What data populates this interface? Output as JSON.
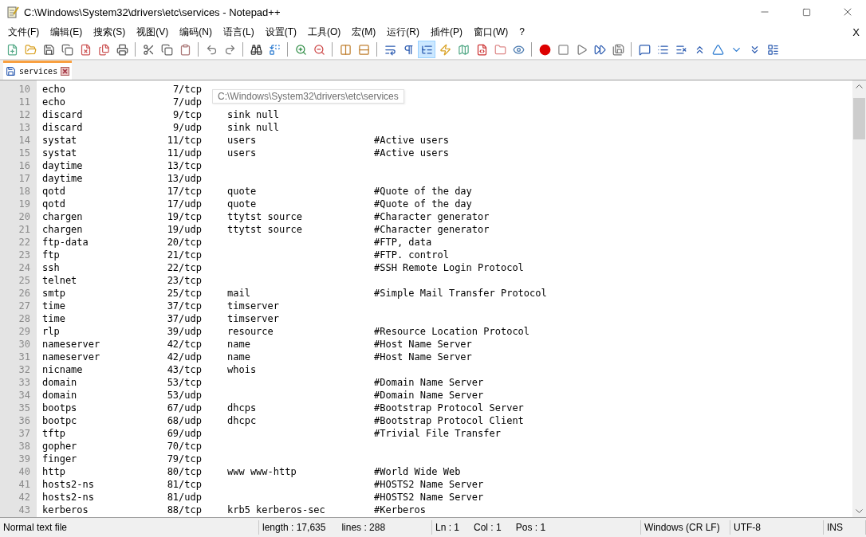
{
  "window": {
    "title": "C:\\Windows\\System32\\drivers\\etc\\services - Notepad++"
  },
  "menu": [
    "文件(F)",
    "编辑(E)",
    "搜索(S)",
    "视图(V)",
    "编码(N)",
    "语言(L)",
    "设置(T)",
    "工具(O)",
    "宏(M)",
    "运行(R)",
    "插件(P)",
    "窗口(W)",
    "?"
  ],
  "menu_close": "X",
  "toolbar": [
    {
      "kind": "button",
      "selected": false
    },
    {
      "kind": "button",
      "selected": false
    },
    {
      "kind": "button",
      "selected": false
    },
    {
      "kind": "button",
      "selected": false
    },
    {
      "kind": "button",
      "selected": false
    },
    {
      "kind": "button",
      "selected": false
    },
    {
      "kind": "button",
      "selected": false
    },
    {
      "kind": "separator"
    },
    {
      "kind": "button",
      "selected": false
    },
    {
      "kind": "button",
      "selected": false
    },
    {
      "kind": "button",
      "selected": false
    },
    {
      "kind": "separator"
    },
    {
      "kind": "button",
      "selected": false
    },
    {
      "kind": "button",
      "selected": false
    },
    {
      "kind": "separator"
    },
    {
      "kind": "button",
      "selected": false
    },
    {
      "kind": "button",
      "selected": false
    },
    {
      "kind": "separator"
    },
    {
      "kind": "button",
      "selected": false
    },
    {
      "kind": "button",
      "selected": false
    },
    {
      "kind": "separator"
    },
    {
      "kind": "button",
      "selected": false
    },
    {
      "kind": "button",
      "selected": false
    },
    {
      "kind": "separator"
    },
    {
      "kind": "button",
      "selected": false
    },
    {
      "kind": "button",
      "selected": false
    },
    {
      "kind": "button",
      "selected": true
    },
    {
      "kind": "button",
      "selected": false
    },
    {
      "kind": "button",
      "selected": false
    },
    {
      "kind": "button",
      "selected": false
    },
    {
      "kind": "button",
      "selected": false
    },
    {
      "kind": "button",
      "selected": false
    },
    {
      "kind": "separator"
    },
    {
      "kind": "button",
      "selected": false
    },
    {
      "kind": "button",
      "selected": false
    },
    {
      "kind": "button",
      "selected": false
    },
    {
      "kind": "button",
      "selected": false
    },
    {
      "kind": "button",
      "selected": false
    },
    {
      "kind": "separator"
    },
    {
      "kind": "button",
      "selected": false
    },
    {
      "kind": "button",
      "selected": false
    },
    {
      "kind": "button",
      "selected": false
    },
    {
      "kind": "button",
      "selected": false
    },
    {
      "kind": "button",
      "selected": false
    },
    {
      "kind": "button",
      "selected": false
    },
    {
      "kind": "button",
      "selected": false
    },
    {
      "kind": "button",
      "selected": false
    }
  ],
  "tabs": [
    {
      "label": "services",
      "selected": true
    }
  ],
  "tooltip": "C:\\Windows\\System32\\drivers\\etc\\services",
  "lines": [
    {
      "number": "10",
      "name": "echo",
      "port": "7/tcp"
    },
    {
      "number": "11",
      "name": "echo",
      "port": "7/udp"
    },
    {
      "number": "12",
      "name": "discard",
      "port": "9/tcp",
      "aliases": "sink null"
    },
    {
      "number": "13",
      "name": "discard",
      "port": "9/udp",
      "aliases": "sink null"
    },
    {
      "number": "14",
      "name": "systat",
      "port": "11/tcp",
      "aliases": "users",
      "comment": "#Active users"
    },
    {
      "number": "15",
      "name": "systat",
      "port": "11/udp",
      "aliases": "users",
      "comment": "#Active users"
    },
    {
      "number": "16",
      "name": "daytime",
      "port": "13/tcp"
    },
    {
      "number": "17",
      "name": "daytime",
      "port": "13/udp"
    },
    {
      "number": "18",
      "name": "qotd",
      "port": "17/tcp",
      "aliases": "quote",
      "comment": "#Quote of the day"
    },
    {
      "number": "19",
      "name": "qotd",
      "port": "17/udp",
      "aliases": "quote",
      "comment": "#Quote of the day"
    },
    {
      "number": "20",
      "name": "chargen",
      "port": "19/tcp",
      "aliases": "ttytst source",
      "comment": "#Character generator"
    },
    {
      "number": "21",
      "name": "chargen",
      "port": "19/udp",
      "aliases": "ttytst source",
      "comment": "#Character generator"
    },
    {
      "number": "22",
      "name": "ftp-data",
      "port": "20/tcp",
      "comment": "#FTP, data"
    },
    {
      "number": "23",
      "name": "ftp",
      "port": "21/tcp",
      "comment": "#FTP. control"
    },
    {
      "number": "24",
      "name": "ssh",
      "port": "22/tcp",
      "comment": "#SSH Remote Login Protocol"
    },
    {
      "number": "25",
      "name": "telnet",
      "port": "23/tcp"
    },
    {
      "number": "26",
      "name": "smtp",
      "port": "25/tcp",
      "aliases": "mail",
      "comment": "#Simple Mail Transfer Protocol"
    },
    {
      "number": "27",
      "name": "time",
      "port": "37/tcp",
      "aliases": "timserver"
    },
    {
      "number": "28",
      "name": "time",
      "port": "37/udp",
      "aliases": "timserver"
    },
    {
      "number": "29",
      "name": "rlp",
      "port": "39/udp",
      "aliases": "resource",
      "comment": "#Resource Location Protocol"
    },
    {
      "number": "30",
      "name": "nameserver",
      "port": "42/tcp",
      "aliases": "name",
      "comment": "#Host Name Server"
    },
    {
      "number": "31",
      "name": "nameserver",
      "port": "42/udp",
      "aliases": "name",
      "comment": "#Host Name Server"
    },
    {
      "number": "32",
      "name": "nicname",
      "port": "43/tcp",
      "aliases": "whois"
    },
    {
      "number": "33",
      "name": "domain",
      "port": "53/tcp",
      "comment": "#Domain Name Server"
    },
    {
      "number": "34",
      "name": "domain",
      "port": "53/udp",
      "comment": "#Domain Name Server"
    },
    {
      "number": "35",
      "name": "bootps",
      "port": "67/udp",
      "aliases": "dhcps",
      "comment": "#Bootstrap Protocol Server"
    },
    {
      "number": "36",
      "name": "bootpc",
      "port": "68/udp",
      "aliases": "dhcpc",
      "comment": "#Bootstrap Protocol Client"
    },
    {
      "number": "37",
      "name": "tftp",
      "port": "69/udp",
      "comment": "#Trivial File Transfer"
    },
    {
      "number": "38",
      "name": "gopher",
      "port": "70/tcp"
    },
    {
      "number": "39",
      "name": "finger",
      "port": "79/tcp"
    },
    {
      "number": "40",
      "name": "http",
      "port": "80/tcp",
      "aliases": "www www-http",
      "comment": "#World Wide Web"
    },
    {
      "number": "41",
      "name": "hosts2-ns",
      "port": "81/tcp",
      "comment": "#HOSTS2 Name Server"
    },
    {
      "number": "42",
      "name": "hosts2-ns",
      "port": "81/udp",
      "comment": "#HOSTS2 Name Server"
    },
    {
      "number": "43",
      "name": "kerberos",
      "port": "88/tcp",
      "aliases": "krb5 kerberos-sec",
      "comment": "#Kerberos"
    }
  ],
  "status_bar": {
    "file_type": "Normal text file",
    "length": "length : 17,635",
    "lines": "lines : 288",
    "ln": "Ln : 1",
    "col": "Col : 1",
    "pos": "Pos : 1",
    "eol": "Windows (CR LF)",
    "encoding": "UTF-8",
    "mode": "INS"
  }
}
